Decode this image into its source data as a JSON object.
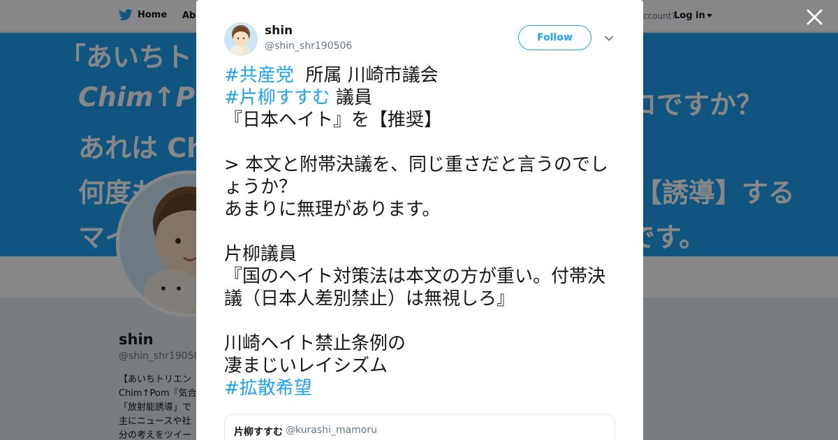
{
  "nav": {
    "home_label": "Home",
    "about_label": "Abo",
    "account_text": "ccount?",
    "login_label": "Log in"
  },
  "banner": {
    "line1": "「あいちトリ",
    "line2": "Chim↑P",
    "line3": "あれは Ch",
    "line4": "何度も",
    "line5": "マイ",
    "line6": "ロですか？",
    "line7": "【誘導】する",
    "line8": "です。"
  },
  "profile": {
    "name": "shin",
    "handle": "@shin_shr190506",
    "bio_lines": [
      "【あいちトリエン",
      "Chim↑Pom『気合",
      "「放射能誘導」で",
      "主にニュースや社",
      "分の考えをツイー"
    ]
  },
  "tweet": {
    "author_name": "shin",
    "author_handle": "@shin_shr190506",
    "follow_label": "Follow",
    "lines": [
      {
        "hashtag": "#共産党",
        "text": "  所属 川崎市議会"
      },
      {
        "hashtag": "#片柳すすむ",
        "text": " 議員"
      },
      {
        "text": "『日本ヘイト』を【推奨】"
      },
      {
        "text": ""
      },
      {
        "text": "> 本文と附帯決議を、同じ重さだと言うのでしょうか？"
      },
      {
        "text": "あまりに無理があります。"
      },
      {
        "text": ""
      },
      {
        "text": "片柳議員"
      },
      {
        "text": "『国のヘイト対策法は本文の方が重い。付帯決議（日本人差別禁止）は無視しろ』"
      },
      {
        "text": ""
      },
      {
        "text": "川崎ヘイト禁止条例の"
      },
      {
        "text": "凄まじいレイシズム"
      },
      {
        "hashtag": "#拡散希望",
        "text": ""
      }
    ],
    "quote": {
      "name": "片柳すすむ",
      "handle": "@kurashi_mamoru"
    }
  },
  "colors": {
    "accent": "#1da1f2",
    "text": "#14171a",
    "muted": "#657786"
  },
  "icons": {
    "nav_logo": "twitter-bird-icon",
    "close": "close-icon",
    "more": "chevron-down-icon"
  }
}
